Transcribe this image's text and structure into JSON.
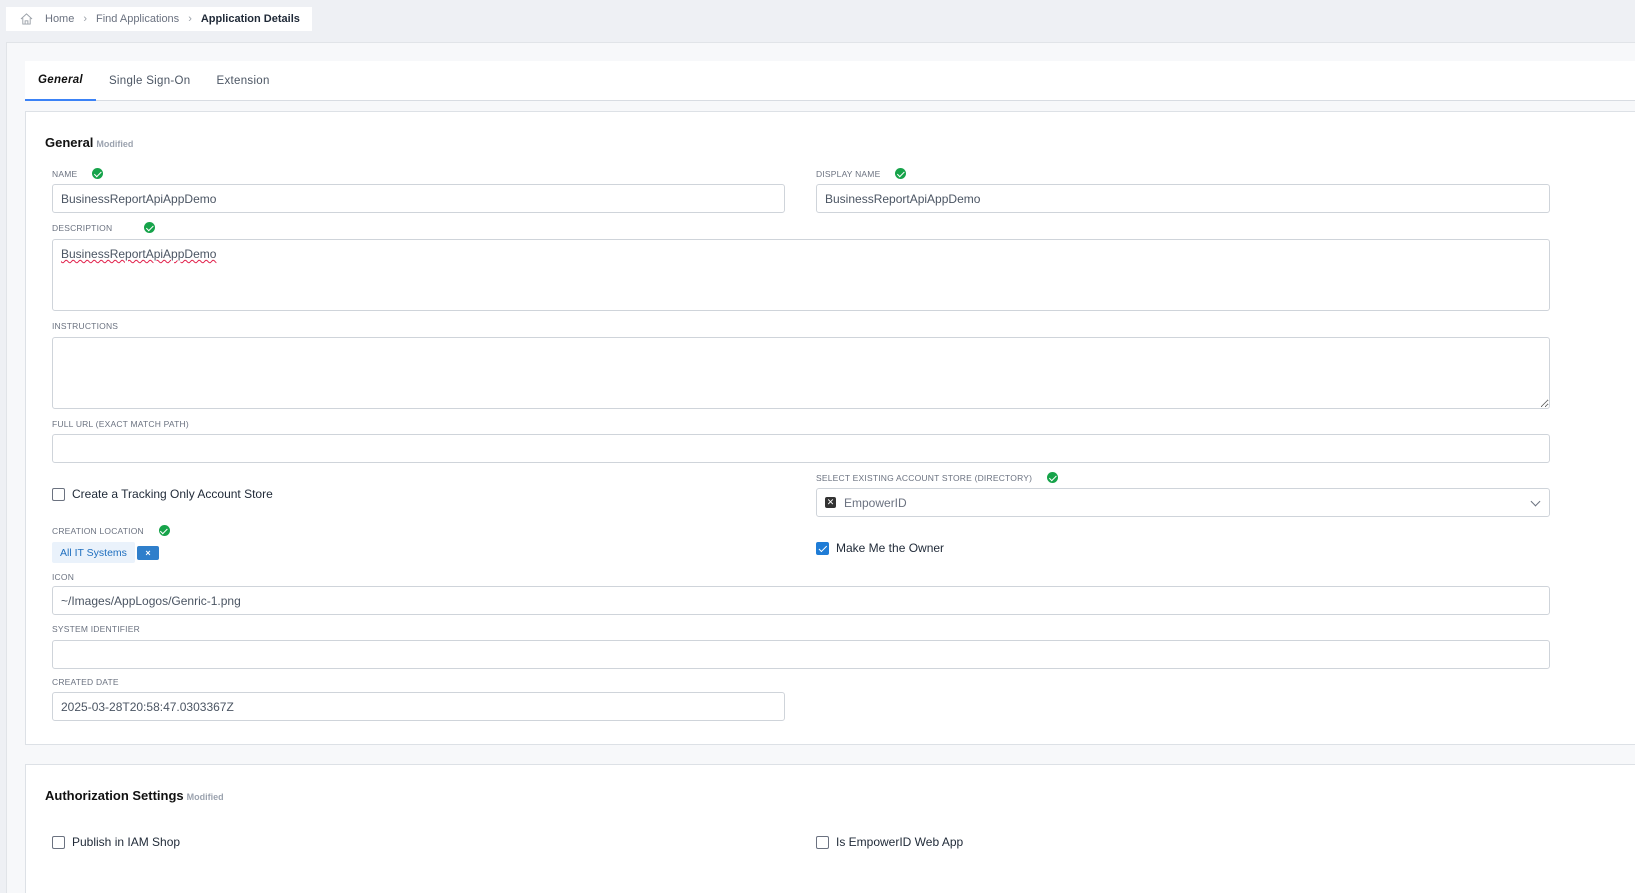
{
  "breadcrumb": {
    "home": "Home",
    "find": "Find Applications",
    "current": "Application Details"
  },
  "tabs": [
    {
      "label": "General",
      "active": true
    },
    {
      "label": "Single Sign-On",
      "active": false
    },
    {
      "label": "Extension",
      "active": false
    }
  ],
  "general": {
    "title": "General",
    "modified": "Modified",
    "name": {
      "label": "NAME",
      "value": "BusinessReportApiAppDemo"
    },
    "display_name": {
      "label": "DISPLAY NAME",
      "value": "BusinessReportApiAppDemo"
    },
    "description": {
      "label": "DESCRIPTION",
      "value": "BusinessReportApiAppDemo"
    },
    "instructions": {
      "label": "INSTRUCTIONS",
      "value": ""
    },
    "full_url": {
      "label": "FULL URL (EXACT MATCH PATH)",
      "value": ""
    },
    "tracking_store": {
      "label": "Create a Tracking Only Account Store",
      "checked": false
    },
    "account_store": {
      "label": "SELECT EXISTING ACCOUNT STORE (DIRECTORY)",
      "value": "EmpowerID"
    },
    "creation_location": {
      "label": "CREATION LOCATION",
      "tag": "All IT Systems",
      "remove": "×"
    },
    "make_owner": {
      "label": "Make Me the Owner",
      "checked": true
    },
    "icon": {
      "label": "ICON",
      "value": "~/Images/AppLogos/Genric-1.png"
    },
    "system_identifier": {
      "label": "SYSTEM IDENTIFIER",
      "value": ""
    },
    "created_date": {
      "label": "CREATED DATE",
      "value": "2025-03-28T20:58:47.0303367Z"
    }
  },
  "authorization": {
    "title": "Authorization Settings",
    "modified": "Modified",
    "publish_iam": {
      "label": "Publish in IAM Shop",
      "checked": false
    },
    "is_web_app": {
      "label": "Is EmpowerID Web App",
      "checked": false
    }
  },
  "colors": {
    "accent": "#1f7cd6",
    "valid": "#16a34a"
  }
}
